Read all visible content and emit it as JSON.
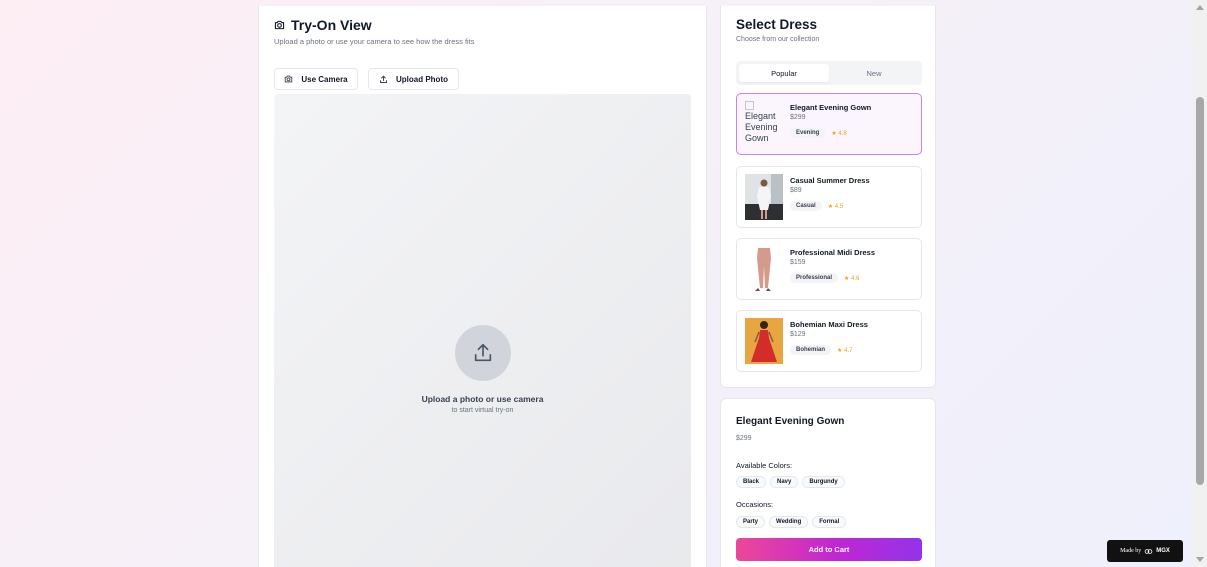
{
  "tryon": {
    "title": "Try-On View",
    "subtitle": "Upload a photo or use your camera to see how the dress fits",
    "use_camera_label": "Use Camera",
    "upload_photo_label": "Upload Photo",
    "upload_prompt": "Upload a photo or use camera",
    "upload_subprompt": "to start virtual try-on"
  },
  "select": {
    "title": "Select Dress",
    "subtitle": "Choose from our collection",
    "tabs": [
      {
        "label": "Popular",
        "active": true
      },
      {
        "label": "New",
        "active": false
      }
    ],
    "dresses": [
      {
        "name": "Elegant Evening Gown",
        "price": "$299",
        "category": "Evening",
        "rating": "★ 4.8",
        "image_alt": "Elegant Evening Gown",
        "selected": true
      },
      {
        "name": "Casual Summer Dress",
        "price": "$89",
        "category": "Casual",
        "rating": "★ 4.5",
        "selected": false
      },
      {
        "name": "Professional Midi Dress",
        "price": "$159",
        "category": "Professional",
        "rating": "★ 4.6",
        "selected": false
      },
      {
        "name": "Bohemian Maxi Dress",
        "price": "$129",
        "category": "Bohemian",
        "rating": "★ 4.7",
        "selected": false
      }
    ]
  },
  "details": {
    "name": "Elegant Evening Gown",
    "price": "$299",
    "colors_label": "Available Colors:",
    "colors": [
      "Black",
      "Navy",
      "Burgundy"
    ],
    "occasions_label": "Occasions:",
    "occasions": [
      "Party",
      "Wedding",
      "Formal"
    ],
    "add_to_cart_label": "Add to Cart"
  },
  "badge": {
    "prefix": "Made by",
    "brand": "MGX"
  },
  "icons": {
    "camera": "camera-icon",
    "upload": "upload-icon"
  },
  "colors": {
    "accent_gradient_start": "#ec4899",
    "accent_gradient_end": "#9333ea",
    "selected_border": "#c084fc",
    "rating": "#f59e0b"
  }
}
